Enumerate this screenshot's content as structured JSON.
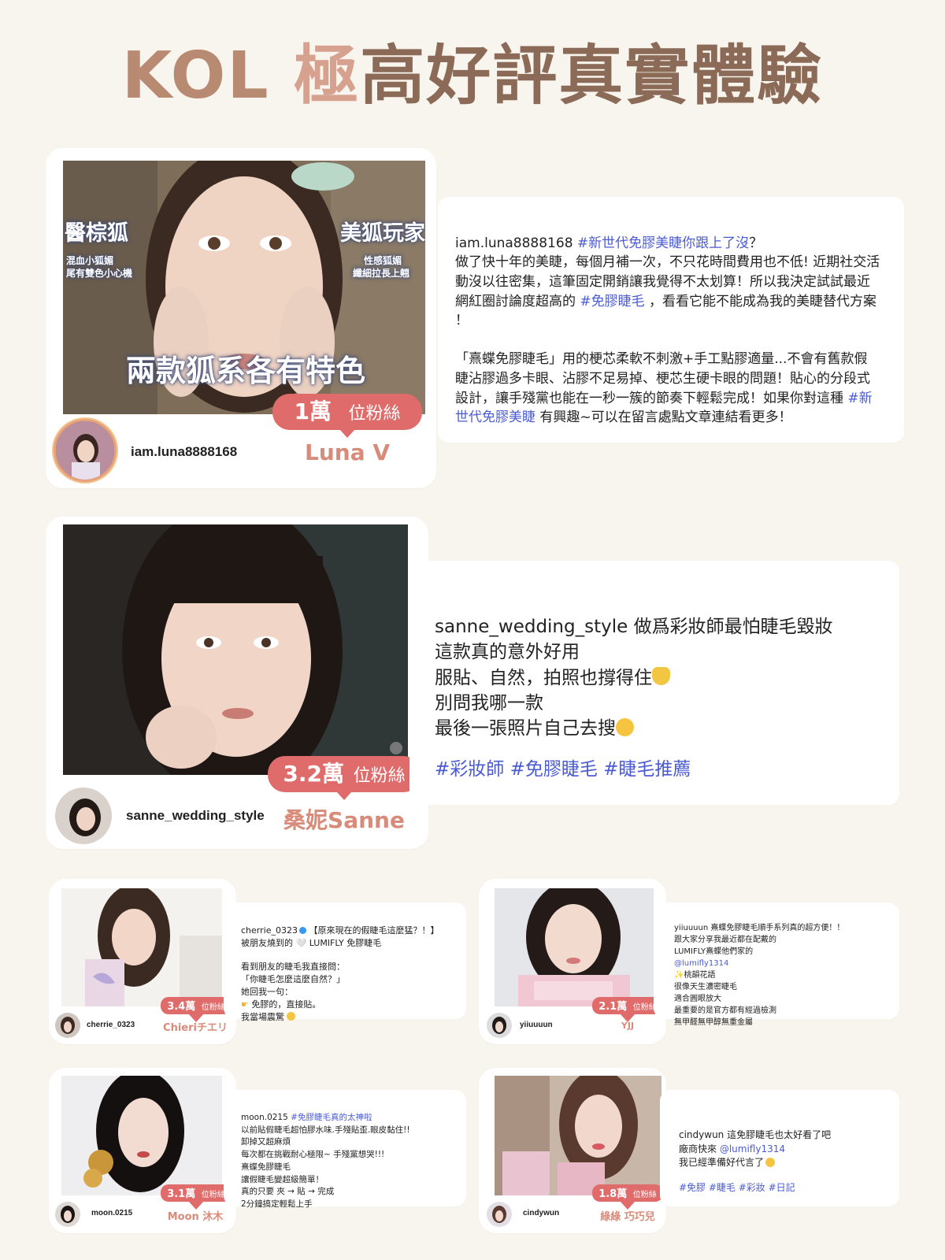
{
  "title": {
    "kol": "KOL",
    "gi": "極",
    "rest": "高好評真實體驗"
  },
  "colors": {
    "background": "#f8f4ee",
    "badge": "#e06b6b",
    "kol_name": "#d98b7a",
    "hashtag": "#4a5bd4",
    "title_brown": "#8b6b58"
  },
  "kols": [
    {
      "handle": "iam.luna8888168",
      "followers_num": "1萬",
      "followers_unit": "位粉絲",
      "name": "Luna V",
      "photo_overlay": {
        "left_top": "醫棕狐",
        "left_sub1": "混血小狐媚",
        "left_sub2": "尾有雙色小心機",
        "right_top": "美狐玩家",
        "right_sub1": "性感狐媚",
        "right_sub2": "纖細拉長上翹",
        "bottom": "兩款狐系各有特色"
      },
      "caption": {
        "p1_handle": "iam.luna8888168 ",
        "p1_tag": "#新世代免膠美睫你跟上了沒",
        "p1_text": "？\n做了快十年的美睫，每個月補一次，不只花時間費用也不低! 近期社交活動沒以往密集，這筆固定開銷讓我覺得不太划算！所以我決定試試最近網紅圈討論度超高的 ",
        "p1_tag2": "#免膠睫毛",
        "p1_text2": " ，看看它能不能成為我的美睫替代方案 ！\n\n「熹蝶免膠睫毛」用的梗芯柔軟不刺激+手工點膠適量...不會有舊款假睫沾膠過多卡眼、沾膠不足易掉、梗芯生硬卡眼的問題！貼心的分段式設計，讓手殘黨也能在一秒一簇的節奏下輕鬆完成！如果你對這種 ",
        "p1_tag3": "#新世代免膠美睫",
        "p1_text3": " 有興趣~可以在留言處點文章連結看更多！"
      }
    },
    {
      "handle": "sanne_wedding_style",
      "followers_num": "3.2萬",
      "followers_unit": "位粉絲",
      "name": "桑妮Sanne",
      "caption": {
        "line1": "sanne_wedding_style 做爲彩妝師最怕睫毛毀妝",
        "line2": "這款真的意外好用",
        "line3": "服貼、自然，拍照也撐得住",
        "line4": "別問我哪一款",
        "line5": "最後一張照片自己去搜",
        "tags": "#彩妝師 #免膠睫毛 #睫毛推薦"
      }
    },
    {
      "handle": "cherrie_0323",
      "followers_num": "3.4萬",
      "followers_unit": "位粉絲",
      "name": "Chieriチエリ",
      "caption": {
        "l1_handle": "cherrie_0323",
        "l1_text": " 【原來現在的假睫毛這麼猛？！】",
        "l2": "被朋友燒到的 🤍 LUMIFLY 免膠睫毛",
        "l3": "看到朋友的睫毛我直接問：",
        "l4": "「你睫毛怎麼這麼自然？」",
        "l5": "她回我一句：",
        "l6": " 免膠的，直接貼。",
        "l7": "我當場震驚"
      }
    },
    {
      "handle": "yiiuuuun",
      "followers_num": "2.1萬",
      "followers_unit": "位粉絲",
      "name": "YJJ",
      "caption": {
        "l1": "yiiuuuun 熹蝶免膠睫毛順手系列真的超方便！！",
        "l2": "跟大家分享我最近都在配戴的",
        "l3": "LUMIFLY熹蝶他們家的",
        "l4": "@lumifly1314",
        "l5": "✨桃韻花語",
        "l6": "很像天生濃密睫毛",
        "l7": "適合圓眼放大",
        "l8": "最重要的是官方都有經過檢測",
        "l9": "無甲醛無甲醇無重金屬"
      }
    },
    {
      "handle": "moon.0215",
      "followers_num": "3.1萬",
      "followers_unit": "位粉絲",
      "name": "Moon 沐木",
      "caption": {
        "l1_handle": "moon.0215 ",
        "l1_tag": "#免膠睫毛真的太神啦",
        "l2": "以前貼假睫毛超怕膠水味.手殘貼歪.眼皮黏住!!",
        "l3": "卸掉又超麻煩",
        "l4": "每次都在挑戰耐心極限~ 手殘黨想哭!!!",
        "l5": "熹蝶免膠睫毛",
        "l6": "讓假睫毛變超級簡單！",
        "l7": "真的只要 夾 → 貼 → 完成",
        "l8": "2分鐘搞定輕鬆上手"
      }
    },
    {
      "handle": "cindywun",
      "followers_num": "1.8萬",
      "followers_unit": "位粉絲",
      "name": "綠綠 巧巧兒",
      "caption": {
        "l1": "cindywun 這免膠睫毛也太好看了吧",
        "l2_text": "廠商快來 ",
        "l2_tag": "@lumifly1314",
        "l3": "我已經準備好代言了",
        "tags": "#免膠 #睫毛 #彩妝 #日記"
      }
    }
  ]
}
